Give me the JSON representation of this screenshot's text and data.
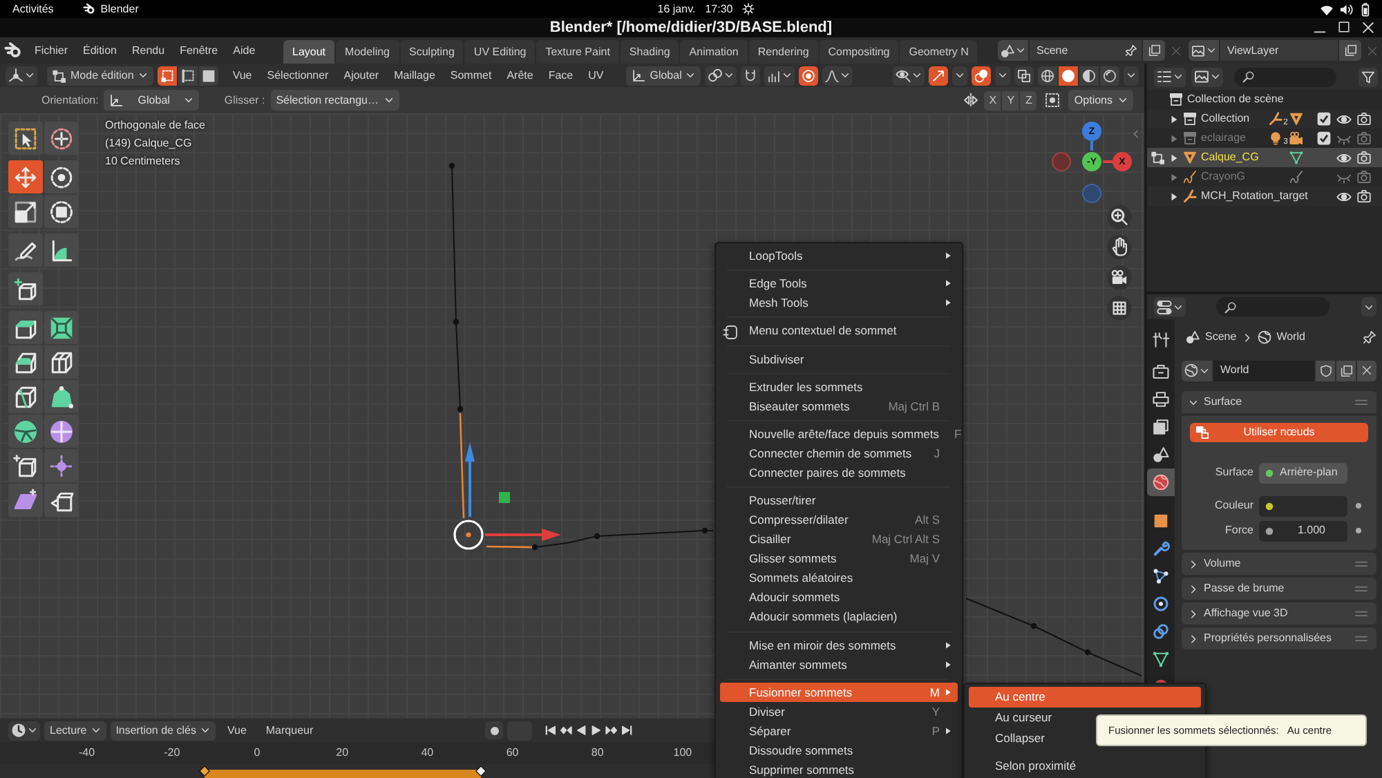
{
  "system_bar": {
    "activities": "Activités",
    "app": "Blender",
    "date": "16 janv.",
    "time": "17:30"
  },
  "window": {
    "title": "Blender* [/home/didier/3D/BASE.blend]"
  },
  "menu_bar": [
    "Fichier",
    "Édition",
    "Rendu",
    "Fenêtre",
    "Aide"
  ],
  "workspace_tabs": [
    {
      "label": "Layout",
      "selected": true
    },
    {
      "label": "Modeling",
      "selected": false
    },
    {
      "label": "Sculpting",
      "selected": false
    },
    {
      "label": "UV Editing",
      "selected": false
    },
    {
      "label": "Texture Paint",
      "selected": false
    },
    {
      "label": "Shading",
      "selected": false
    },
    {
      "label": "Animation",
      "selected": false
    },
    {
      "label": "Rendering",
      "selected": false
    },
    {
      "label": "Compositing",
      "selected": false
    },
    {
      "label": "Geometry N",
      "selected": false
    }
  ],
  "scene_selector": {
    "value": "Scene"
  },
  "view_layer_selector": {
    "value": "ViewLayer"
  },
  "viewport_header": {
    "mode": "Mode édition",
    "select_modes": [
      {
        "selected": true
      },
      {
        "selected": false
      },
      {
        "selected": false
      }
    ],
    "menus": [
      "Vue",
      "Sélectionner",
      "Ajouter",
      "Maillage",
      "Sommet",
      "Arête",
      "Face",
      "UV"
    ],
    "orientation": "Global",
    "snapping": {
      "on": false
    },
    "proportional_editing": {
      "on": true
    },
    "gizmos": {
      "on": true
    },
    "overlays": {
      "on": true
    },
    "xray": {
      "on": false
    },
    "shading_modes": [
      {
        "selected": false
      },
      {
        "selected": true
      },
      {
        "selected": false
      },
      {
        "selected": false
      }
    ]
  },
  "tool_settings": {
    "orientation_label": "Orientation:",
    "orientation": "Global",
    "drag_label": "Glisser :",
    "drag": "Sélection rectangu…",
    "mirror_axes": [
      {
        "label": "X",
        "on": false
      },
      {
        "label": "Y",
        "on": false
      },
      {
        "label": "Z",
        "on": false
      }
    ],
    "options": "Options"
  },
  "viewport": {
    "info": [
      "Orthogonale de face",
      "(149) Calque_CG",
      "10 Centimeters"
    ],
    "navigation_axes": [
      "Z",
      "-Y",
      "X"
    ]
  },
  "toolbar": [
    [
      {
        "selected": false
      },
      {
        "selected": false
      }
    ],
    [
      {
        "selected": true
      },
      {
        "selected": false
      },
      {
        "selected": false
      },
      {
        "selected": false
      }
    ],
    [
      {
        "selected": false
      },
      {
        "selected": false
      }
    ],
    [
      {
        "selected": false
      }
    ],
    [
      {
        "selected": false
      },
      {
        "selected": false
      },
      {
        "selected": false
      },
      {
        "selected": false
      },
      {
        "selected": false
      },
      {
        "selected": false
      },
      {
        "selected": false
      },
      {
        "selected": false
      },
      {
        "selected": false
      },
      {
        "selected": false
      },
      {
        "selected": false
      },
      {
        "selected": false
      }
    ]
  ],
  "outliner": {
    "root": "Collection de scène",
    "items": [
      {
        "name": "Collection",
        "kind": "collection",
        "count": "2",
        "expanded": false,
        "checked": true,
        "visible": true,
        "selected": false
      },
      {
        "name": "eclairage",
        "kind": "collection",
        "count": "3",
        "expanded": false,
        "checked": true,
        "visible": false,
        "selected": false
      },
      {
        "name": "Calque_CG",
        "kind": "mesh",
        "expanded": false,
        "visible": true,
        "selected": true
      },
      {
        "name": "CrayonG",
        "kind": "grease_pencil",
        "expanded": false,
        "visible": false,
        "selected": false
      },
      {
        "name": "MCH_Rotation_target",
        "kind": "armature",
        "expanded": false,
        "visible": true,
        "selected": false
      }
    ]
  },
  "properties": {
    "tabs": [
      [
        {
          "selected": false
        }
      ],
      [
        {
          "selected": false
        },
        {
          "selected": false
        },
        {
          "selected": false
        },
        {
          "selected": false
        },
        {
          "selected": true
        }
      ],
      [
        {
          "selected": false
        },
        {
          "selected": false
        },
        {
          "selected": false
        },
        {
          "selected": false
        },
        {
          "selected": false
        },
        {
          "selected": false
        },
        {
          "selected": false
        }
      ]
    ],
    "breadcrumb": [
      "Scene",
      "World"
    ],
    "datablock": "World",
    "panels": [
      {
        "title": "Surface",
        "expanded": true,
        "use_nodes": "Utiliser nœuds",
        "fields": [
          {
            "label": "Surface",
            "kind": "shader",
            "value": "Arrière-plan",
            "color": "#63c763"
          },
          {
            "label": "Couleur",
            "kind": "color",
            "color": "#c7c729"
          },
          {
            "label": "Force",
            "kind": "number",
            "value": "1.000",
            "color": "#a1a1a1"
          }
        ]
      },
      {
        "title": "Volume",
        "expanded": false
      },
      {
        "title": "Passe de brume",
        "expanded": false
      },
      {
        "title": "Affichage vue 3D",
        "expanded": false
      },
      {
        "title": "Propriétés personnalisées",
        "expanded": false
      }
    ]
  },
  "timeline": {
    "dropdowns": [
      "Lecture",
      "Insertion de clés"
    ],
    "menus": [
      "Vue",
      "Marqueur"
    ],
    "auto_keying": {
      "on": false
    },
    "ruler": [
      "-40",
      "-20",
      "0",
      "20",
      "40",
      "60",
      "80",
      "100"
    ]
  },
  "context_menu": {
    "groups": [
      [
        {
          "label": "LoopTools",
          "submenu": true,
          "selected": false
        }
      ],
      [
        {
          "label": "Edge Tools",
          "submenu": true,
          "selected": false
        },
        {
          "label": "Mesh Tools",
          "submenu": true,
          "selected": false
        }
      ],
      [
        {
          "label": "Menu contextuel de sommet",
          "icon": true,
          "submenu": false,
          "selected": false
        }
      ],
      [
        {
          "label": "Subdiviser",
          "submenu": false,
          "selected": false
        }
      ],
      [
        {
          "label": "Extruder les sommets",
          "submenu": false,
          "selected": false
        },
        {
          "label": "Biseauter sommets",
          "shortcut": "Maj Ctrl B",
          "submenu": false,
          "selected": false
        }
      ],
      [
        {
          "label": "Nouvelle arête/face depuis sommets",
          "shortcut": "F",
          "submenu": false,
          "selected": false
        },
        {
          "label": "Connecter chemin de sommets",
          "shortcut": "J",
          "submenu": false,
          "selected": false
        },
        {
          "label": "Connecter paires de sommets",
          "submenu": false,
          "selected": false
        }
      ],
      [
        {
          "label": "Pousser/tirer",
          "submenu": false,
          "selected": false
        },
        {
          "label": "Compresser/dilater",
          "shortcut": "Alt S",
          "submenu": false,
          "selected": false
        },
        {
          "label": "Cisailler",
          "shortcut": "Maj Ctrl Alt S",
          "submenu": false,
          "selected": false
        },
        {
          "label": "Glisser sommets",
          "shortcut": "Maj V",
          "submenu": false,
          "selected": false
        },
        {
          "label": "Sommets aléatoires",
          "submenu": false,
          "selected": false
        },
        {
          "label": "Adoucir sommets",
          "submenu": false,
          "selected": false
        },
        {
          "label": "Adoucir sommets (laplacien)",
          "submenu": false,
          "selected": false
        }
      ],
      [
        {
          "label": "Mise en miroir des sommets",
          "submenu": true,
          "selected": false
        },
        {
          "label": "Aimanter sommets",
          "submenu": true,
          "selected": false
        }
      ],
      [
        {
          "label": "Fusionner sommets",
          "shortcut": "M",
          "submenu": true,
          "selected": true
        },
        {
          "label": "Diviser",
          "shortcut": "Y",
          "submenu": false,
          "selected": false
        },
        {
          "label": "Séparer",
          "shortcut": "P",
          "submenu": true,
          "selected": false
        },
        {
          "label": "Dissoudre sommets",
          "submenu": false,
          "selected": false
        },
        {
          "label": "Supprimer sommets",
          "submenu": false,
          "selected": false
        }
      ]
    ]
  },
  "merge_submenu": {
    "groups": [
      [
        {
          "label": "Au centre",
          "selected": true
        },
        {
          "label": "Au curseur",
          "selected": false
        },
        {
          "label": "Collapser",
          "selected": false
        }
      ],
      [
        {
          "label": "Selon proximité",
          "selected": false
        }
      ]
    ]
  },
  "tooltip": {
    "text": "Fusionner les sommets sélectionnés:",
    "value": "Au centre"
  }
}
